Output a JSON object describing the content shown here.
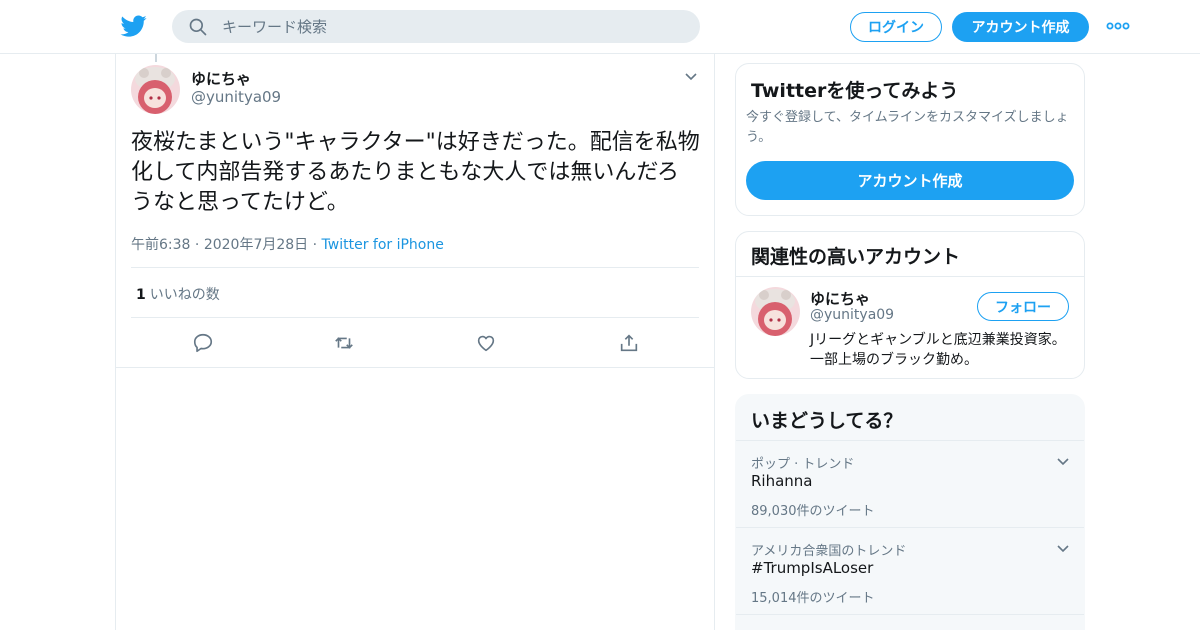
{
  "header": {
    "search_placeholder": "キーワード検索",
    "login_label": "ログイン",
    "create_account_label": "アカウント作成",
    "brand_color": "#1da1f2"
  },
  "tweet": {
    "display_name": "ゆにちゃ",
    "handle": "@yunitya09",
    "text": "夜桜たまという\"キャラクター\"は好きだった。配信を私物化して内部告発するあたりまともな大人では無いんだろうなと思ってたけど。",
    "time": "午前6:38",
    "date": "2020年7月28日",
    "source": "Twitter for iPhone",
    "like_count": "1",
    "like_label": "いいねの数",
    "actions": [
      "reply-icon",
      "retweet-icon",
      "like-icon",
      "share-icon"
    ]
  },
  "signup_card": {
    "title": "Twitterを使ってみよう",
    "description": "今すぐ登録して、タイムラインをカスタマイズしましょう。",
    "button_label": "アカウント作成"
  },
  "related_card": {
    "title": "関連性の高いアカウント",
    "account": {
      "display_name": "ゆにちゃ",
      "handle": "@yunitya09",
      "bio": "Jリーグとギャンブルと底辺兼業投資家。一部上場のブラック勤め。",
      "follow_label": "フォロー"
    }
  },
  "trends_card": {
    "title": "いまどうしてる？",
    "items": [
      {
        "context": "ポップ · トレンド",
        "name": "Rihanna",
        "count": "89,030件のツイート"
      },
      {
        "context": "アメリカ合衆国のトレンド",
        "name": "#TrumpIsALoser",
        "count": "15,014件のツイート"
      }
    ]
  }
}
